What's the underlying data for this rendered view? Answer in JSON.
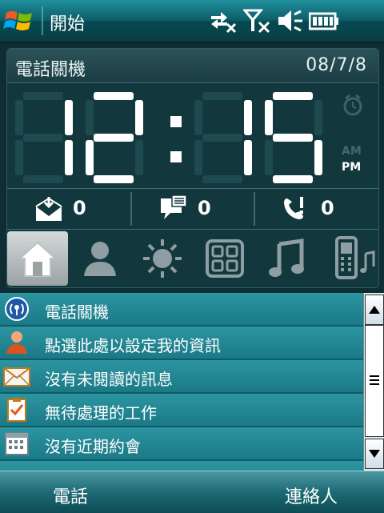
{
  "titlebar": {
    "title": "開始"
  },
  "clock": {
    "status_label": "電話關機",
    "date": "08/7/8",
    "hours": "12",
    "minutes": "15",
    "am_label": "AM",
    "pm_label": "PM",
    "period": "PM"
  },
  "counters": {
    "voicemail": "0",
    "messages": "0",
    "missed_calls": "0"
  },
  "plugin_tabs": [
    "home-icon",
    "contact-icon",
    "weather-icon",
    "apps-grid-icon",
    "music-icon",
    "phone-music-icon"
  ],
  "list": {
    "items": [
      {
        "icon": "wireless-icon",
        "label": "電話關機"
      },
      {
        "icon": "owner-info-icon",
        "label": "點選此處以設定我的資訊"
      },
      {
        "icon": "mail-icon",
        "label": "沒有未閱讀的訊息"
      },
      {
        "icon": "tasks-icon",
        "label": "無待處理的工作"
      },
      {
        "icon": "calendar-icon",
        "label": "沒有近期約會"
      }
    ]
  },
  "softkeys": {
    "left": "電話",
    "right": "連絡人"
  },
  "colors": {
    "accent": "#1d7f8b",
    "panel": "#12383e",
    "digit": "#ffffff"
  }
}
